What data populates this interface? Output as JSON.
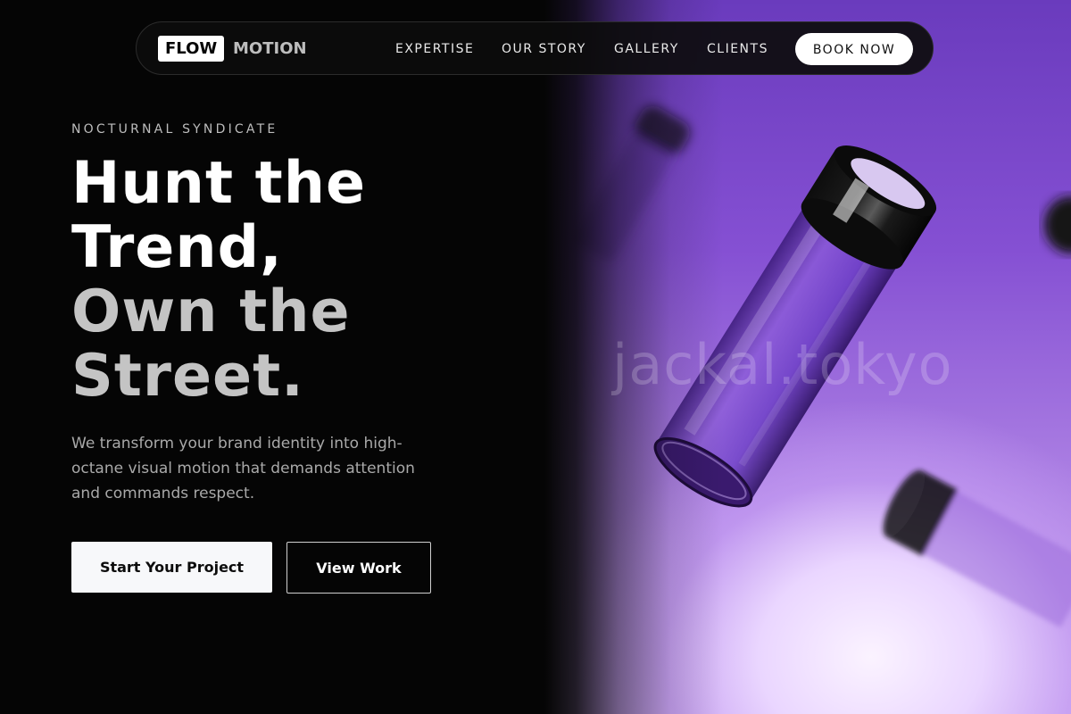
{
  "nav": {
    "logo_primary": "FLOW",
    "logo_secondary": "MOTION",
    "links": [
      "EXPERTISE",
      "OUR STORY",
      "GALLERY",
      "CLIENTS"
    ],
    "cta_label": "BOOK NOW"
  },
  "hero": {
    "eyebrow": "NOCTURNAL SYNDICATE",
    "headline_lines": [
      "Hunt the",
      "Trend,",
      "Own the",
      "Street."
    ],
    "description": "We transform your brand identity into high-octane visual motion that demands attention and commands respect.",
    "primary_cta": "Start Your Project",
    "secondary_cta": "View Work"
  },
  "visual": {
    "watermark": "jackal.tokyo",
    "subject": "purple-glass-tubes"
  },
  "colors": {
    "background": "#050505",
    "accent_purple": "#8550d3",
    "white": "#ffffff",
    "muted_text": "#a9a9a9"
  }
}
